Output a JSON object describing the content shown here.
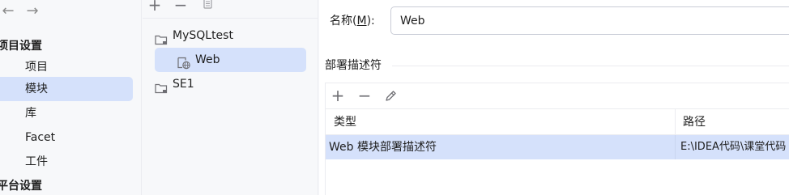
{
  "nav": {
    "back_glyph": "←",
    "forward_glyph": "→",
    "project_settings": "项目设置",
    "items": [
      {
        "label": "项目"
      },
      {
        "label": "模块"
      },
      {
        "label": "库"
      },
      {
        "label": "Facet"
      },
      {
        "label": "工件"
      }
    ],
    "platform_settings": "平台设置"
  },
  "tree": {
    "toolbar": {
      "add": "+",
      "remove": "−"
    },
    "nodes": [
      {
        "label": "MySQLtest"
      },
      {
        "label": "Web"
      },
      {
        "label": "SE1"
      }
    ]
  },
  "details": {
    "name_label_prefix": "名称(",
    "name_label_mnemonic": "M",
    "name_label_suffix": "):",
    "name_value": "Web",
    "descriptors_title": "部署描述符",
    "toolbar": {
      "add": "+",
      "remove": "−"
    },
    "columns": [
      "类型",
      "路径"
    ],
    "rows": [
      {
        "type": "Web 模块部署描述符",
        "path": "E:\\IDEA代码\\课堂代码"
      }
    ]
  },
  "colors": {
    "selection": "#d5e1fb",
    "sidebar_bg": "#f7f8fa",
    "content_bg": "#ffffff",
    "border": "#ebecf0"
  }
}
